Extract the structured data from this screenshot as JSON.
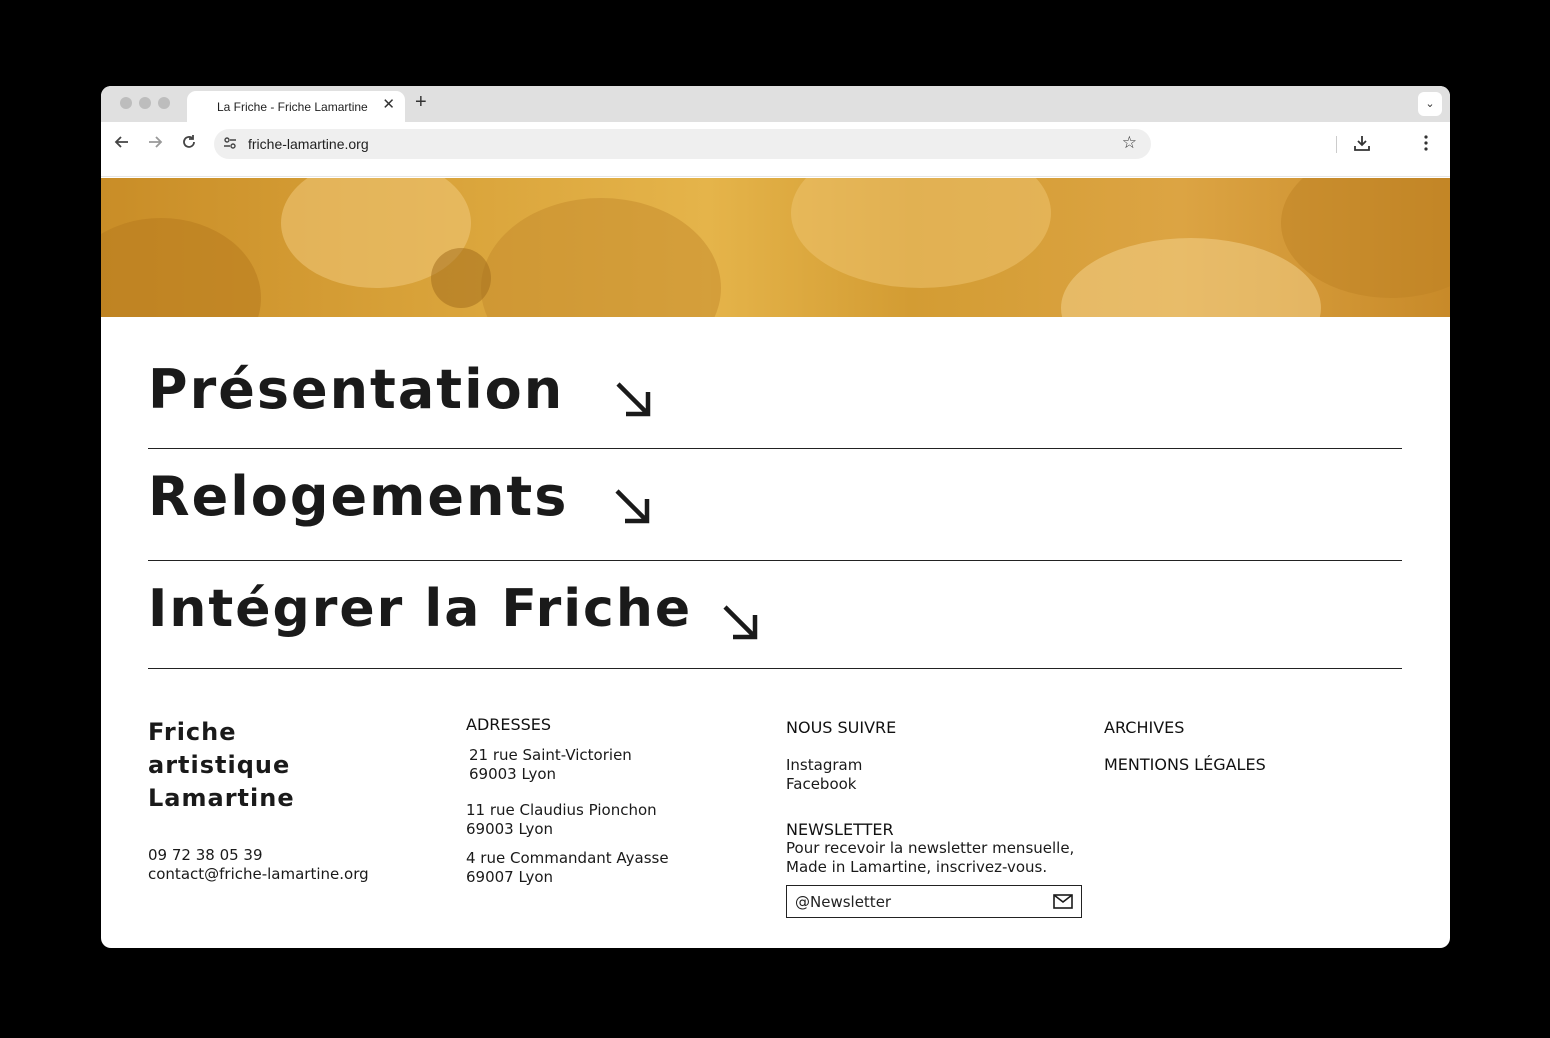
{
  "browser": {
    "tab_title": "La Friche - Friche Lamartine",
    "tab_close": "✕",
    "new_tab": "+",
    "tab_menu": "⌄",
    "url": "friche-lamartine.org",
    "icons": [
      "back-icon",
      "forward-icon",
      "reload-icon",
      "site-settings-icon",
      "bookmark-star-icon",
      "download-icon",
      "kebab-menu-icon"
    ]
  },
  "nav": {
    "items": [
      {
        "label": "Présentation"
      },
      {
        "label": "Relogements"
      },
      {
        "label": "Intégrer la Friche"
      }
    ]
  },
  "footer": {
    "brand": [
      "Friche",
      "artistique",
      "Lamartine"
    ],
    "phone": "09 72 38 05 39",
    "email": "contact@friche-lamartine.org",
    "addresses_title": "ADRESSES",
    "addresses": [
      {
        "street": "21 rue Saint-Victorien",
        "city": "69003 Lyon"
      },
      {
        "street": "11 rue Claudius Pionchon",
        "city": "69003 Lyon"
      },
      {
        "street": "4 rue Commandant Ayasse",
        "city": "69007 Lyon"
      }
    ],
    "follow_title": "NOUS SUIVRE",
    "social": [
      "Instagram",
      "Facebook"
    ],
    "newsletter_title": "NEWSLETTER",
    "newsletter_text": [
      "Pour recevoir la newsletter mensuelle,",
      "Made in Lamartine, inscrivez-vous."
    ],
    "newsletter_placeholder": "@Newsletter",
    "links": [
      "ARCHIVES",
      "MENTIONS LÉGALES"
    ]
  },
  "colors": {
    "hero": "#d9a33a",
    "text": "#1a1a1a"
  }
}
